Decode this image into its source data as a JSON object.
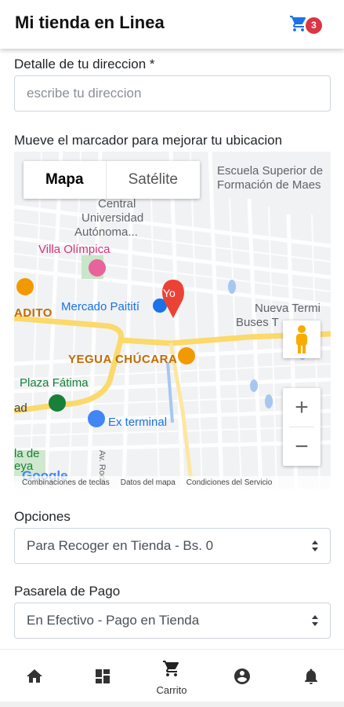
{
  "header": {
    "title": "Mi tienda en Linea",
    "cart_count": "3",
    "cart_icon": "cart-icon"
  },
  "address": {
    "label": "Detalle de tu direccion *",
    "placeholder": "escribe tu direccion",
    "value": ""
  },
  "map_section": {
    "label": "Mueve el marcador para mejorar tu ubicacion",
    "map_type": {
      "map": "Mapa",
      "satellite": "Satélite",
      "selected": "Mapa"
    },
    "marker_label": "Yo",
    "places": {
      "escuela": "Escuela Superior de",
      "formacion": "Formación de Maes",
      "central": "Central",
      "universidad": "Universidad",
      "autonoma": "Autónoma...",
      "villa": "Villa Olímpica",
      "mercado": "Mercado Paitití",
      "nueva": "Nueva Termi",
      "buses": "Buses T",
      "adito": "ADITO",
      "yegua": "YEGUA CHÚCARA",
      "plaza": "Plaza Fátima",
      "ad": "ad",
      "ex_terminal": "Ex terminal",
      "la": "la de",
      "eya": "eya",
      "av_rodo": "Av. Rodo"
    },
    "google": "Google",
    "footer": {
      "shortcuts": "Combinaciones de teclas",
      "map_data": "Datos del mapa",
      "terms": "Condiciones del Servicio"
    },
    "zoom_in": "+",
    "zoom_out": "−"
  },
  "options": {
    "label": "Opciones",
    "selected": "Para Recoger en Tienda - Bs. 0"
  },
  "payment": {
    "label": "Pasarela de Pago",
    "selected": "En Efectivo - Pago en Tienda"
  },
  "bottom_nav": [
    {
      "icon": "home-icon",
      "label": ""
    },
    {
      "icon": "dashboard-icon",
      "label": ""
    },
    {
      "icon": "cart-icon",
      "label": "Carrito"
    },
    {
      "icon": "account-icon",
      "label": ""
    },
    {
      "icon": "bell-icon",
      "label": ""
    }
  ],
  "colors": {
    "accent": "#1a73e8",
    "badge": "#dc3545",
    "marker": "#ea4335",
    "road": "#fbd96b"
  }
}
